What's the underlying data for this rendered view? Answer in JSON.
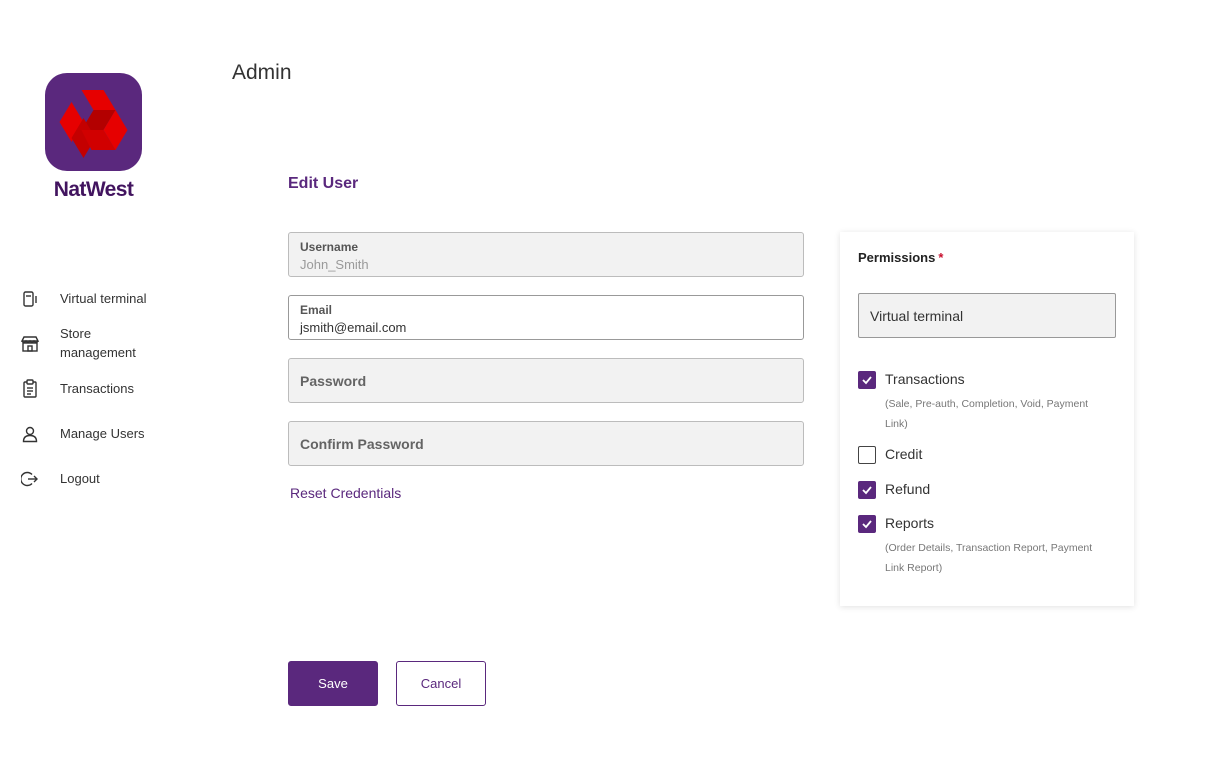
{
  "brand": {
    "name": "NatWest",
    "logo_color": "#5a287d",
    "logo_accent": "#e60000"
  },
  "page": {
    "title": "Admin"
  },
  "sidebar": {
    "items": [
      {
        "label": "Virtual terminal",
        "icon": "card-terminal-icon"
      },
      {
        "label": "Store management",
        "icon": "store-icon"
      },
      {
        "label": "Transactions",
        "icon": "clipboard-icon"
      },
      {
        "label": "Manage Users",
        "icon": "user-icon"
      },
      {
        "label": "Logout",
        "icon": "logout-icon"
      }
    ]
  },
  "form": {
    "title": "Edit User",
    "username": {
      "label": "Username",
      "value": "John_Smith"
    },
    "email": {
      "label": "Email",
      "value": "jsmith@email.com"
    },
    "password": {
      "placeholder": "Password"
    },
    "confirm_password": {
      "placeholder": "Confirm Password"
    },
    "reset_link": "Reset Credentials"
  },
  "permissions": {
    "title": "Permissions",
    "required_marker": "*",
    "selected_group": "Virtual terminal",
    "items": [
      {
        "label": "Transactions",
        "checked": true,
        "description": "(Sale, Pre-auth, Completion, Void, Payment Link)"
      },
      {
        "label": "Credit",
        "checked": false,
        "description": ""
      },
      {
        "label": "Refund",
        "checked": true,
        "description": ""
      },
      {
        "label": "Reports",
        "checked": true,
        "description": "(Order Details, Transaction Report, Payment Link Report)"
      }
    ]
  },
  "actions": {
    "save_label": "Save",
    "cancel_label": "Cancel"
  },
  "colors": {
    "primary": "#5a287d",
    "required": "#c8102e",
    "field_bg": "#f2f2f2"
  }
}
